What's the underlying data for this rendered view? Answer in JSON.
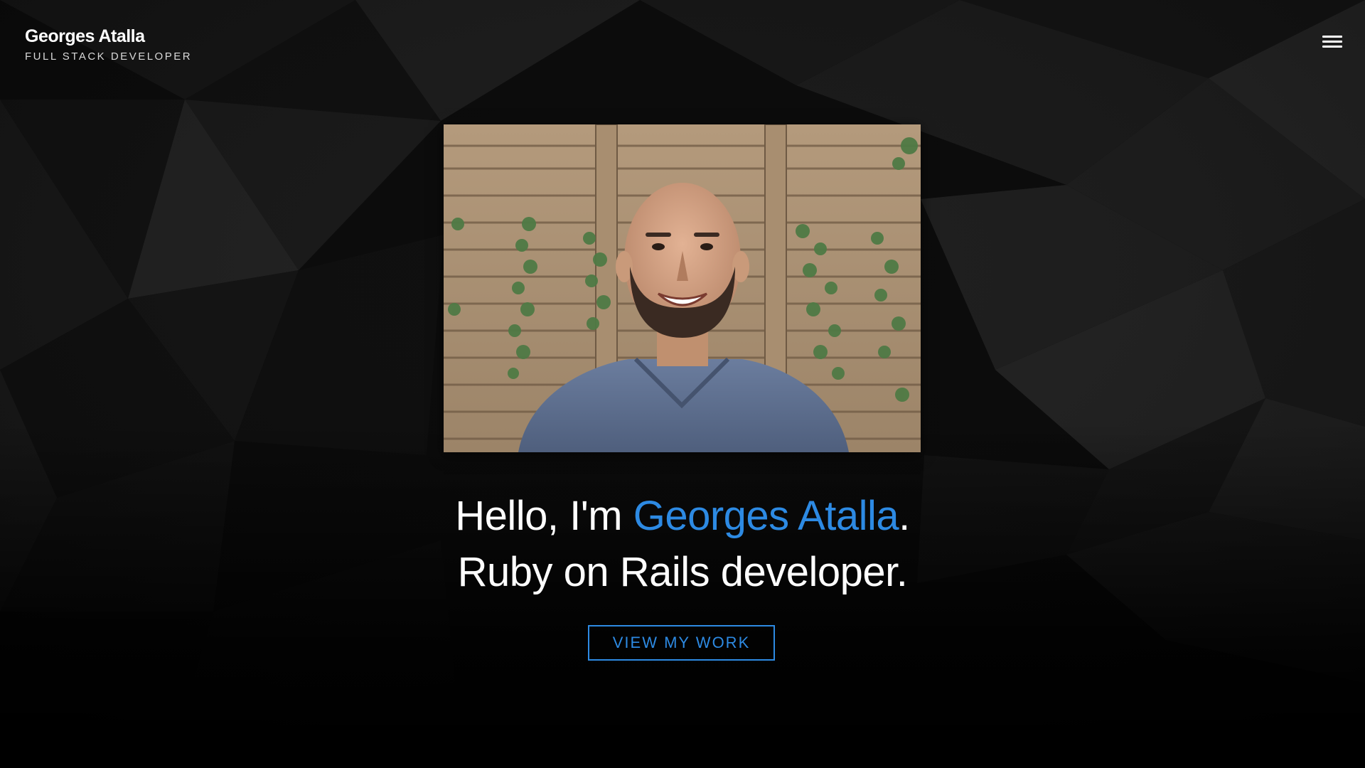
{
  "header": {
    "name": "Georges Atalla",
    "role": "FULL STACK DEVELOPER",
    "menu_icon": "hamburger-icon"
  },
  "hero": {
    "greeting_prefix": "Hello, I'm ",
    "greeting_name": "Georges Atalla",
    "greeting_suffix": ".",
    "tagline": "Ruby on Rails developer.",
    "cta_label": "VIEW MY WORK"
  },
  "colors": {
    "accent": "#2d8ae3",
    "background": "#060606",
    "text": "#ffffff"
  }
}
